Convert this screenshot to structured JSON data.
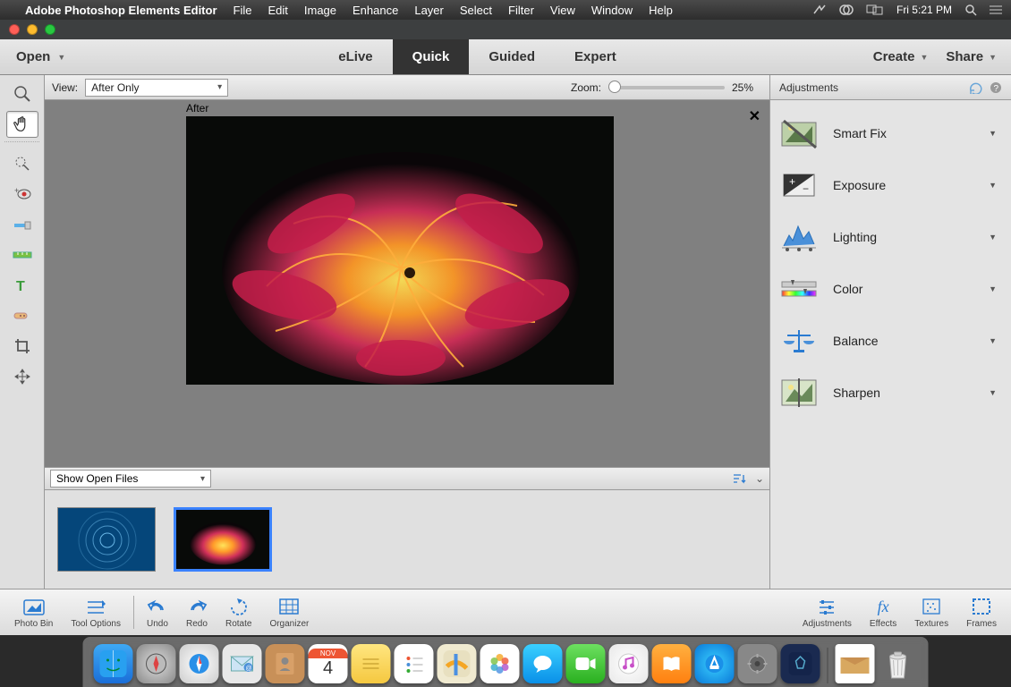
{
  "menubar": {
    "app_name": "Adobe Photoshop Elements Editor",
    "items": [
      "File",
      "Edit",
      "Image",
      "Enhance",
      "Layer",
      "Select",
      "Filter",
      "View",
      "Window",
      "Help"
    ],
    "clock": "Fri 5:21 PM"
  },
  "apptabs": {
    "open_label": "Open",
    "tabs": [
      "eLive",
      "Quick",
      "Guided",
      "Expert"
    ],
    "active_tab": "Quick",
    "create_label": "Create",
    "share_label": "Share"
  },
  "tools": [
    {
      "name": "zoom-tool",
      "label": "Zoom"
    },
    {
      "name": "hand-tool",
      "label": "Hand",
      "active": true
    },
    {
      "name": "quick-select-tool",
      "label": "Quick Selection"
    },
    {
      "name": "redeye-tool",
      "label": "Red Eye"
    },
    {
      "name": "whiten-tool",
      "label": "Whiten Teeth"
    },
    {
      "name": "straighten-tool",
      "label": "Straighten"
    },
    {
      "name": "type-tool",
      "label": "Type"
    },
    {
      "name": "spot-heal-tool",
      "label": "Spot Healing"
    },
    {
      "name": "crop-tool",
      "label": "Crop"
    },
    {
      "name": "move-tool",
      "label": "Move"
    }
  ],
  "canvasbar": {
    "view_label": "View:",
    "view_value": "After Only",
    "zoom_label": "Zoom:",
    "zoom_value": "25%"
  },
  "canvas": {
    "after_label": "After"
  },
  "filebar": {
    "dropdown_value": "Show Open Files"
  },
  "adjust_panel": {
    "title": "Adjustments",
    "items": [
      "Smart Fix",
      "Exposure",
      "Lighting",
      "Color",
      "Balance",
      "Sharpen"
    ]
  },
  "bottombar": {
    "left": [
      {
        "name": "photo-bin",
        "label": "Photo Bin"
      },
      {
        "name": "tool-options",
        "label": "Tool Options"
      },
      {
        "name": "undo",
        "label": "Undo"
      },
      {
        "name": "redo",
        "label": "Redo"
      },
      {
        "name": "rotate",
        "label": "Rotate"
      },
      {
        "name": "organizer",
        "label": "Organizer"
      }
    ],
    "right": [
      {
        "name": "adjustments",
        "label": "Adjustments"
      },
      {
        "name": "effects",
        "label": "Effects"
      },
      {
        "name": "textures",
        "label": "Textures"
      },
      {
        "name": "frames",
        "label": "Frames"
      }
    ]
  },
  "dock": {
    "items": [
      "finder",
      "launchpad",
      "safari",
      "mail",
      "contacts",
      "calendar",
      "notes",
      "reminders",
      "maps",
      "photos",
      "messages",
      "facetime",
      "itunes",
      "ibooks",
      "appstore",
      "preferences",
      "pse"
    ],
    "right_items": [
      "downloads",
      "trash"
    ],
    "calendar_month": "NOV",
    "calendar_day": "4"
  }
}
